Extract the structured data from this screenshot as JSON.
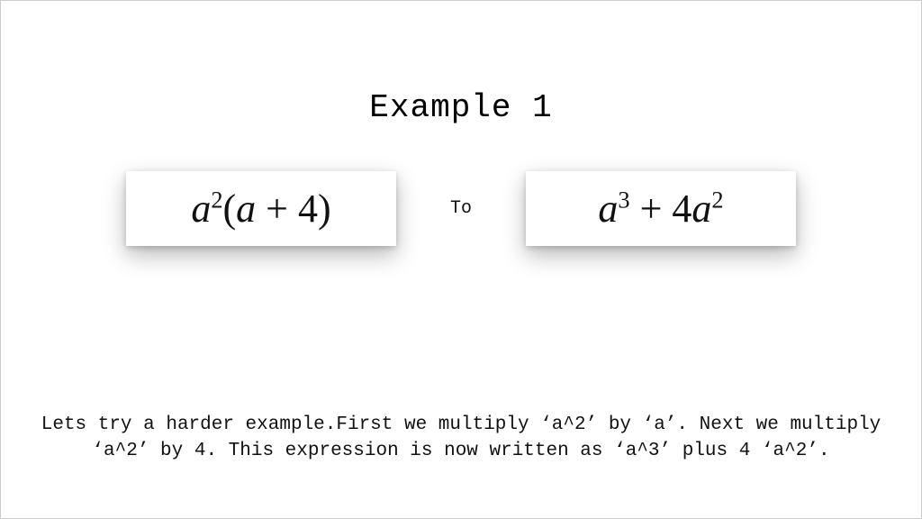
{
  "title": "Example 1",
  "connector": "To",
  "left_expression": {
    "a": "a",
    "exp": "2",
    "open": "(",
    "inner_a": "a",
    "plus": " + ",
    "four": "4",
    "close": ")"
  },
  "right_expression": {
    "a1": "a",
    "exp1": "3",
    "plus": " + ",
    "four": "4",
    "a2": "a",
    "exp2": "2"
  },
  "description": "Lets try a harder example.First we multiply ‘a^2’ by ‘a’. Next we multiply ‘a^2’ by 4. This expression is now written as ‘a^3’ plus 4 ‘a^2’."
}
